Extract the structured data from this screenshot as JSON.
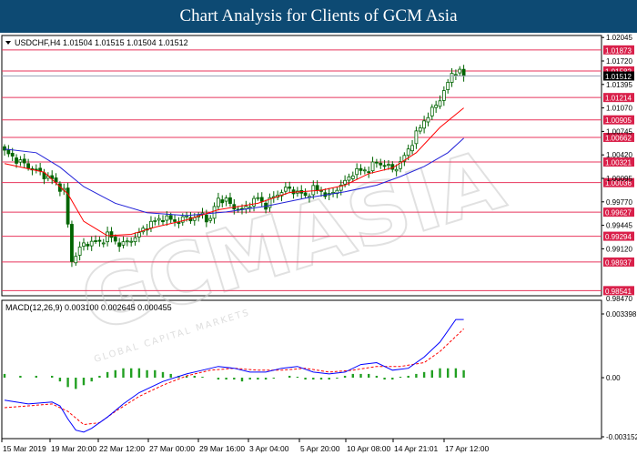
{
  "header": {
    "title": "Chart Analysis for Clients of GCM Asia"
  },
  "watermark": {
    "main": "GCMASIA",
    "sub": "GLOBAL CAPITAL MARKETS"
  },
  "colors": {
    "banner": "#0d4a73",
    "level_line": "#e8365d",
    "level_box": "#d9204a",
    "ma_fast": "#ff0000",
    "ma_slow": "#2323d8",
    "candle": "#006400",
    "macd_line": "#0000ff",
    "signal_line": "#ff0000",
    "histogram": "#22a022",
    "price_marker": "#000000"
  },
  "chart_data": [
    {
      "type": "candlestick",
      "title": "USDCHF,H4 1.01504 1.01515 1.01504 1.01512",
      "symbol": "USDCHF",
      "timeframe": "H4",
      "ohlc": {
        "open": 1.01504,
        "high": 1.01515,
        "low": 1.01504,
        "close": 1.01512
      },
      "ylim": [
        0.9847,
        1.0206
      ],
      "y_ticks": [
        1.02045,
        1.0172,
        1.01395,
        1.0107,
        1.00745,
        1.0042,
        1.00095,
        0.9977,
        0.99445,
        0.9912
      ],
      "x_ticks": [
        "15 Mar 2019",
        "19 Mar 20:00",
        "22 Mar 12:00",
        "27 Mar 00:00",
        "29 Mar 16:00",
        "3 Apr 04:00",
        "5 Apr 20:00",
        "10 Apr 08:00",
        "14 Apr 21:01",
        "17 Apr 12:00"
      ],
      "levels": [
        1.01873,
        1.01582,
        1.01214,
        1.00905,
        1.00662,
        1.00321,
        1.00036,
        0.99627,
        0.99294,
        0.98937,
        0.98541
      ],
      "current_price": {
        "value": 1.01512,
        "label": "1.01512"
      },
      "close_path": [
        [
          0,
          1.0046
        ],
        [
          4,
          1.0032
        ],
        [
          8,
          1.002
        ],
        [
          12,
          1.0008
        ],
        [
          15,
          0.9992
        ],
        [
          16,
          0.9945
        ],
        [
          17,
          0.9895
        ],
        [
          18,
          0.9905
        ],
        [
          20,
          0.9918
        ],
        [
          22,
          0.9922
        ],
        [
          24,
          0.992
        ],
        [
          26,
          0.9932
        ],
        [
          28,
          0.9922
        ],
        [
          30,
          0.9918
        ],
        [
          32,
          0.9925
        ],
        [
          34,
          0.9932
        ],
        [
          36,
          0.9945
        ],
        [
          38,
          0.995
        ],
        [
          40,
          0.9955
        ],
        [
          42,
          0.9952
        ],
        [
          44,
          0.995
        ],
        [
          46,
          0.9956
        ],
        [
          48,
          0.9954
        ],
        [
          50,
          0.996
        ],
        [
          52,
          0.995
        ],
        [
          53,
          0.997
        ],
        [
          54,
          0.9982
        ],
        [
          56,
          0.9978
        ],
        [
          58,
          0.997
        ],
        [
          60,
          0.9964
        ],
        [
          62,
          0.9975
        ],
        [
          64,
          0.9982
        ],
        [
          66,
          0.9972
        ],
        [
          68,
          0.9984
        ],
        [
          70,
          0.9992
        ],
        [
          72,
          0.9995
        ],
        [
          74,
          0.999
        ],
        [
          76,
          0.9985
        ],
        [
          78,
          0.9995
        ],
        [
          80,
          0.9992
        ],
        [
          82,
          0.9984
        ],
        [
          84,
          0.9996
        ],
        [
          86,
          1.0004
        ],
        [
          88,
          1.0018
        ],
        [
          90,
          1.002
        ],
        [
          92,
          1.0022
        ],
        [
          94,
          1.0032
        ],
        [
          96,
          1.0028
        ],
        [
          98,
          1.0022
        ],
        [
          100,
          1.003
        ],
        [
          102,
          1.005
        ],
        [
          104,
          1.007
        ],
        [
          106,
          1.009
        ],
        [
          108,
          1.0103
        ],
        [
          110,
          1.012
        ],
        [
          112,
          1.014
        ],
        [
          113,
          1.0155
        ],
        [
          114,
          1.0158
        ],
        [
          115,
          1.0156
        ],
        [
          116,
          1.0151
        ]
      ],
      "moving_average_fast": [
        [
          0,
          1.003
        ],
        [
          10,
          1.0018
        ],
        [
          16,
          0.9988
        ],
        [
          20,
          0.995
        ],
        [
          26,
          0.993
        ],
        [
          32,
          0.9932
        ],
        [
          38,
          0.9942
        ],
        [
          46,
          0.9952
        ],
        [
          54,
          0.9966
        ],
        [
          64,
          0.9975
        ],
        [
          72,
          0.999
        ],
        [
          80,
          0.9993
        ],
        [
          86,
          1.0
        ],
        [
          92,
          1.0016
        ],
        [
          98,
          1.0024
        ],
        [
          104,
          1.0045
        ],
        [
          110,
          1.008
        ],
        [
          116,
          1.0107
        ]
      ],
      "moving_average_slow": [
        [
          0,
          1.005
        ],
        [
          8,
          1.0045
        ],
        [
          14,
          1.0025
        ],
        [
          20,
          0.9998
        ],
        [
          28,
          0.9975
        ],
        [
          36,
          0.9962
        ],
        [
          46,
          0.9958
        ],
        [
          56,
          0.9963
        ],
        [
          66,
          0.9971
        ],
        [
          76,
          0.9982
        ],
        [
          86,
          0.9991
        ],
        [
          94,
          1.0
        ],
        [
          100,
          1.0012
        ],
        [
          106,
          1.0026
        ],
        [
          112,
          1.0045
        ],
        [
          116,
          1.0065
        ]
      ]
    },
    {
      "type": "line",
      "title": "MACD(12,26,9) 0.003100 0.002645 0.000455",
      "ylim": [
        -0.003152,
        0.003398
      ],
      "y_ticks": [
        0.003398,
        0.0,
        -0.003152
      ],
      "series": [
        {
          "name": "MACD",
          "style": "line",
          "values": [
            [
              0,
              -0.0012
            ],
            [
              6,
              -0.0014
            ],
            [
              12,
              -0.0013
            ],
            [
              14,
              -0.0015
            ],
            [
              16,
              -0.0022
            ],
            [
              18,
              -0.0028
            ],
            [
              20,
              -0.0029
            ],
            [
              22,
              -0.0027
            ],
            [
              26,
              -0.0021
            ],
            [
              30,
              -0.0014
            ],
            [
              34,
              -0.0008
            ],
            [
              40,
              -0.0002
            ],
            [
              46,
              0.0002
            ],
            [
              50,
              0.0004
            ],
            [
              54,
              0.0006
            ],
            [
              58,
              0.0005
            ],
            [
              62,
              0.0003
            ],
            [
              66,
              0.0003
            ],
            [
              70,
              0.0005
            ],
            [
              74,
              0.0006
            ],
            [
              78,
              0.0003
            ],
            [
              82,
              0.0002
            ],
            [
              86,
              0.0003
            ],
            [
              90,
              0.0007
            ],
            [
              94,
              0.0008
            ],
            [
              98,
              0.0004
            ],
            [
              102,
              0.0005
            ],
            [
              106,
              0.0011
            ],
            [
              110,
              0.0019
            ],
            [
              114,
              0.0031
            ],
            [
              116,
              0.0031
            ]
          ]
        },
        {
          "name": "Signal",
          "style": "dashed",
          "values": [
            [
              0,
              -0.0016
            ],
            [
              6,
              -0.0015
            ],
            [
              12,
              -0.0014
            ],
            [
              16,
              -0.0018
            ],
            [
              20,
              -0.0025
            ],
            [
              24,
              -0.0024
            ],
            [
              28,
              -0.0018
            ],
            [
              34,
              -0.001
            ],
            [
              40,
              -0.0004
            ],
            [
              46,
              0.0001
            ],
            [
              52,
              0.0004
            ],
            [
              58,
              0.0005
            ],
            [
              64,
              0.0004
            ],
            [
              70,
              0.0004
            ],
            [
              76,
              0.0005
            ],
            [
              82,
              0.0003
            ],
            [
              88,
              0.0004
            ],
            [
              94,
              0.0006
            ],
            [
              100,
              0.0006
            ],
            [
              106,
              0.0008
            ],
            [
              110,
              0.0014
            ],
            [
              114,
              0.0022
            ],
            [
              116,
              0.0026
            ]
          ]
        },
        {
          "name": "Histogram",
          "style": "bar",
          "values": [
            [
              0,
              0.0002
            ],
            [
              4,
              0.0001
            ],
            [
              8,
              0.0001
            ],
            [
              12,
              0.0001
            ],
            [
              14,
              -0.0002
            ],
            [
              16,
              -0.0005
            ],
            [
              18,
              -0.0006
            ],
            [
              20,
              -0.0004
            ],
            [
              22,
              -0.0002
            ],
            [
              24,
              0.0001
            ],
            [
              26,
              0.0003
            ],
            [
              28,
              0.0004
            ],
            [
              30,
              0.0005
            ],
            [
              32,
              0.0005
            ],
            [
              34,
              0.0005
            ],
            [
              36,
              0.0004
            ],
            [
              38,
              0.0004
            ],
            [
              40,
              0.0003
            ],
            [
              42,
              0.0002
            ],
            [
              44,
              0.0001
            ],
            [
              46,
              0.0001
            ],
            [
              48,
              0.0001
            ],
            [
              50,
              5e-05
            ],
            [
              54,
              -0.0001
            ],
            [
              56,
              -0.0001
            ],
            [
              58,
              -0.0001
            ],
            [
              60,
              -0.0002
            ],
            [
              62,
              -0.0001
            ],
            [
              64,
              -0.0001
            ],
            [
              66,
              -0.0001
            ],
            [
              68,
              -5e-05
            ],
            [
              72,
              0.0001
            ],
            [
              74,
              5e-05
            ],
            [
              76,
              -0.0001
            ],
            [
              78,
              -0.0001
            ],
            [
              80,
              -0.0001
            ],
            [
              82,
              -0.0001
            ],
            [
              84,
              -5e-05
            ],
            [
              86,
              0.0001
            ],
            [
              88,
              0.0002
            ],
            [
              90,
              0.0002
            ],
            [
              92,
              0.0002
            ],
            [
              94,
              0.0001
            ],
            [
              96,
              -0.0001
            ],
            [
              98,
              -0.0001
            ],
            [
              100,
              5e-05
            ],
            [
              102,
              0.0001
            ],
            [
              104,
              0.0002
            ],
            [
              106,
              0.0003
            ],
            [
              108,
              0.0004
            ],
            [
              110,
              0.0005
            ],
            [
              112,
              0.0005
            ],
            [
              114,
              0.0005
            ],
            [
              116,
              0.0004
            ]
          ]
        }
      ]
    }
  ]
}
